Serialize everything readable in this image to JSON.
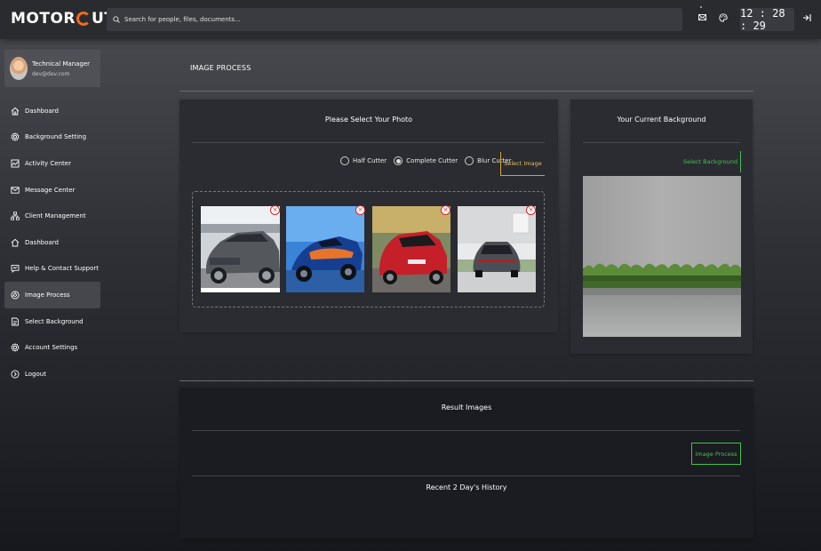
{
  "app": {
    "logo_left": "MOTOR",
    "logo_right": "UT"
  },
  "search": {
    "placeholder": "Search for people, files, documents..."
  },
  "clock": {
    "time": "12 : 28 : 29"
  },
  "profile": {
    "name": "Technical Manager",
    "email": "dev@dev.com"
  },
  "sidebar": {
    "items": [
      {
        "label": "Dashboard",
        "icon": "home-icon"
      },
      {
        "label": "Background Setting",
        "icon": "gear-icon"
      },
      {
        "label": "Activity Center",
        "icon": "activity-icon"
      },
      {
        "label": "Message Center",
        "icon": "mail-icon"
      },
      {
        "label": "Client Management",
        "icon": "hierarchy-icon"
      },
      {
        "label": "Dashboard",
        "icon": "home-icon"
      },
      {
        "label": "Help & Contact Support",
        "icon": "help-icon"
      },
      {
        "label": "Image Process",
        "icon": "image-process-icon"
      },
      {
        "label": "Select Background",
        "icon": "select-background-icon"
      },
      {
        "label": "Account Settings",
        "icon": "gear-icon"
      },
      {
        "label": "Logout",
        "icon": "logout-icon"
      }
    ],
    "active_index": 7
  },
  "main": {
    "title": "IMAGE PROCESS",
    "select_photo": {
      "title": "Please Select Your Photo",
      "options": [
        "Half Cutter",
        "Complete Cutter",
        "Blur Cutter"
      ],
      "selected_option": "Complete Cutter",
      "select_button": "Select Image",
      "images": [
        "grey-mercedes-hatchback",
        "blue-orange-race-car",
        "red-honda-hatchback",
        "grey-porsche-rear"
      ]
    },
    "background": {
      "title": "Your Current Background",
      "select_button": "Select Background"
    },
    "results": {
      "title": "Result Images",
      "process_button": "Image Process",
      "history_title": "Recent 2 Day's History"
    }
  },
  "colors": {
    "accent_orange": "#f26a1b",
    "gold": "#d1a53a",
    "green": "#41c34d",
    "remove_red": "#dd2222"
  }
}
